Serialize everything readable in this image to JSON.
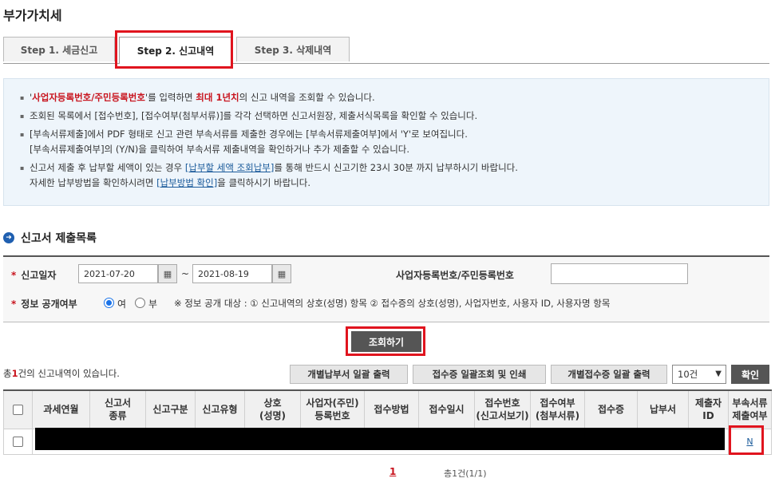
{
  "page_title": "부가가치세",
  "tabs": [
    {
      "label": "Step 1. 세금신고"
    },
    {
      "label": "Step 2. 신고내역"
    },
    {
      "label": "Step 3. 삭제내역"
    }
  ],
  "notice": {
    "l1_q1": "'",
    "l1_hl": "사업자등록번호/주민등록번호",
    "l1_mid": "'를 입력하면 ",
    "l1_hl2": "최대 1년치",
    "l1_end": "의 신고 내역을 조회할 수 있습니다.",
    "l2": "조회된 목록에서 [접수번호], [접수여부(첨부서류)]를 각각 선택하면 신고서원장, 제출서식목록을 확인할 수 있습니다.",
    "l3a": "[부속서류제출]에서 PDF 형태로 신고 관련 부속서류를 제출한 경우에는 [부속서류제출여부]에서 'Y'로 보여집니다.",
    "l3b": "[부속서류제출여부]의 (Y/N)을 클릭하여 부속서류 제출내역을 확인하거나 추가 제출할 수 있습니다.",
    "l4a_start": "신고서 제출 후 납부할 세액이 있는 경우 ",
    "l4a_link": "[납부할 세액 조회납부]",
    "l4a_end": "를 통해 반드시 신고기한 23시 30분 까지 납부하시기 바랍니다.",
    "l4b_start": "자세한 납부방법을 확인하시려면 ",
    "l4b_link": "[납부방법 확인]",
    "l4b_end": "을 클릭하시기 바랍니다."
  },
  "section_title": "신고서 제출목록",
  "search": {
    "date_label": "신고일자",
    "date_from": "2021-07-20",
    "date_to": "2021-08-19",
    "tilde": "~",
    "biz_label": "사업자등록번호/주민등록번호",
    "info_label": "정보 공개여부",
    "opt_yes": "여",
    "opt_no": "부",
    "note": "※ 정보 공개 대상 : ① 신고내역의 상호(성명) 항목 ② 접수증의 상호(성명), 사업자번호, 사용자 ID, 사용자명 항목",
    "required_mark": "*"
  },
  "search_button": "조회하기",
  "result": {
    "count_prefix": "총",
    "count_num": "1",
    "count_suffix": "건의 신고내역이 있습니다."
  },
  "actions": {
    "btn1": "개별납부서 일괄 출력",
    "btn2": "접수증 일괄조회 및 인쇄",
    "btn3": "개별접수증 일괄 출력",
    "page_size": "10건",
    "confirm": "확인"
  },
  "table": {
    "headers": [
      {
        "l1": "과세연월",
        "l2": ""
      },
      {
        "l1": "신고서",
        "l2": "종류"
      },
      {
        "l1": "신고구분",
        "l2": ""
      },
      {
        "l1": "신고유형",
        "l2": ""
      },
      {
        "l1": "상호",
        "l2": "(성명)"
      },
      {
        "l1": "사업자(주민)",
        "l2": "등록번호"
      },
      {
        "l1": "접수방법",
        "l2": ""
      },
      {
        "l1": "접수일시",
        "l2": ""
      },
      {
        "l1": "접수번호",
        "l2": "(신고서보기)"
      },
      {
        "l1": "접수여부",
        "l2": "(첨부서류)"
      },
      {
        "l1": "접수증",
        "l2": ""
      },
      {
        "l1": "납부서",
        "l2": ""
      },
      {
        "l1": "제출자",
        "l2": "ID"
      },
      {
        "l1": "부속서류",
        "l2": "제출여부"
      }
    ],
    "row_attach": "N"
  },
  "pager": {
    "current": "1",
    "total": "총1건(1/1)"
  },
  "colors": {
    "highlight_red": "#e0141e",
    "link_blue": "#1a5a9a",
    "notice_bg": "#eef5fb"
  }
}
